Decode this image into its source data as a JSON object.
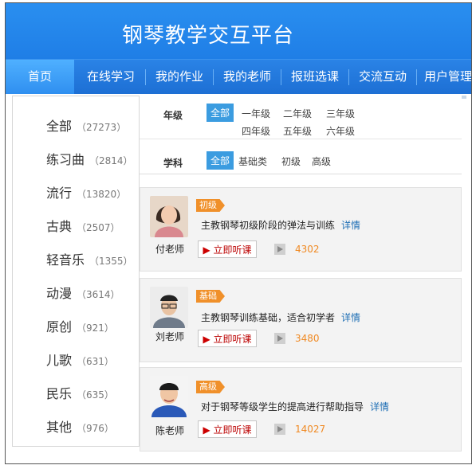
{
  "header": {
    "title": "钢琴教学交互平台"
  },
  "nav": {
    "items": [
      "首页",
      "在线学习",
      "我的作业",
      "我的老师",
      "报班选课",
      "交流互动",
      "用户管理"
    ],
    "active_index": 0
  },
  "sidebar": {
    "categories": [
      {
        "name": "全部",
        "count": "（27273）"
      },
      {
        "name": "练习曲",
        "count": "（2814）"
      },
      {
        "name": "流行",
        "count": "（13820）"
      },
      {
        "name": "古典",
        "count": "（2507）"
      },
      {
        "name": "轻音乐",
        "count": "（1355）"
      },
      {
        "name": "动漫",
        "count": "（3614）"
      },
      {
        "name": "原创",
        "count": "（921）"
      },
      {
        "name": "儿歌",
        "count": "（631）"
      },
      {
        "name": "民乐",
        "count": "（635）"
      },
      {
        "name": "其他",
        "count": "（976）"
      }
    ]
  },
  "filters": {
    "grade": {
      "label": "年级",
      "selected": "全部",
      "options": [
        "一年级",
        "二年级",
        "三年级",
        "四年级",
        "五年级",
        "六年级"
      ]
    },
    "subject": {
      "label": "学科",
      "selected": "全部",
      "options": [
        "基础类",
        "初级",
        "高级"
      ]
    }
  },
  "courses": [
    {
      "teacher": "付老师",
      "tag": "初级",
      "description": "主教钢琴初级阶段的弹法与训练",
      "detail_label": "详情",
      "button_label": "立即听课",
      "plays": "4302"
    },
    {
      "teacher": "刘老师",
      "tag": "基础",
      "description": "主教钢琴训练基础，适合初学者",
      "detail_label": "详情",
      "button_label": "立即听课",
      "plays": "3480"
    },
    {
      "teacher": "陈老师",
      "tag": "高级",
      "description": "对于钢琴等级学生的提高进行帮助指导",
      "detail_label": "详情",
      "button_label": "立即听课",
      "plays": "14027"
    }
  ],
  "colors": {
    "brand_blue": "#2a8ff0",
    "accent_orange": "#f0902a",
    "chip_blue": "#3b9ce0",
    "link_blue": "#1f6fb5"
  }
}
